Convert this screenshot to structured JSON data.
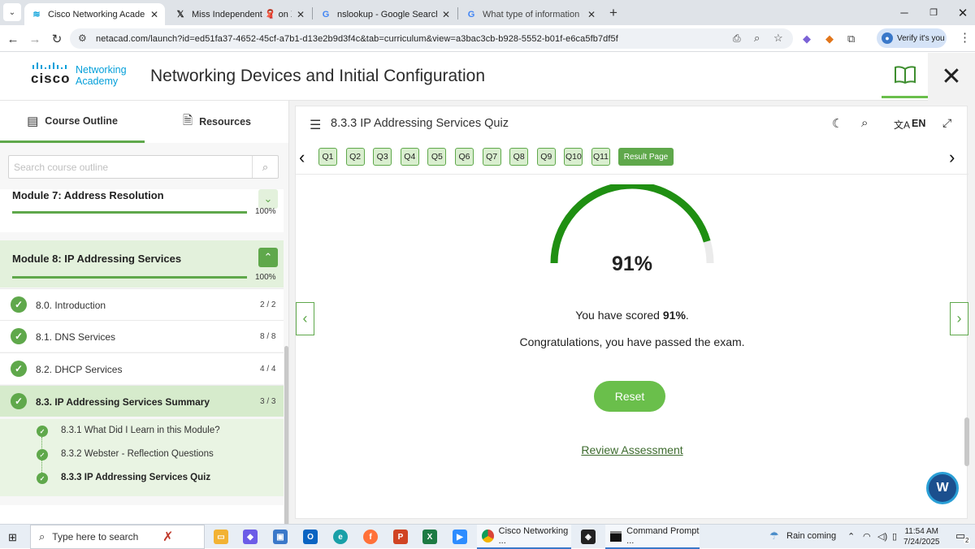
{
  "browser": {
    "tabs": [
      {
        "title": "Cisco Networking Academy: Ne",
        "active": true
      },
      {
        "title": "Miss Independent 🧣 on X: \"My",
        "active": false
      },
      {
        "title": "nslookup - Google Search",
        "active": false
      },
      {
        "title": "What type of information is con",
        "active": false
      }
    ],
    "url_host": "netacad.com",
    "url_path": "/launch?id=ed51fa37-4652-45cf-a7b1-d13e2b9d3f4c&tab=curriculum&view=a3bac3cb-b928-5552-b01f-e6ca5fb7df5f",
    "verify_label": "Verify it's you"
  },
  "header": {
    "logo_brand": "cisco",
    "logo_line1": "Networking",
    "logo_line2": "Academy",
    "title": "Networking Devices and Initial Configuration"
  },
  "sidebar": {
    "tabs": [
      {
        "label": "Course Outline",
        "active": true
      },
      {
        "label": "Resources",
        "active": false
      }
    ],
    "search_placeholder": "Search course outline",
    "modules": [
      {
        "title": "Module 7: Address Resolution",
        "progress": "100%",
        "expanded": false
      },
      {
        "title": "Module 8: IP Addressing Services",
        "progress": "100%",
        "expanded": true
      }
    ],
    "items": [
      {
        "label": "8.0. Introduction",
        "count": "2 / 2"
      },
      {
        "label": "8.1. DNS Services",
        "count": "8 / 8"
      },
      {
        "label": "8.2. DHCP Services",
        "count": "4 / 4"
      },
      {
        "label": "8.3. IP Addressing Services Summary",
        "count": "3 / 3",
        "selected": true
      }
    ],
    "subitems": [
      {
        "label": "8.3.1 What Did I Learn in this Module?"
      },
      {
        "label": "8.3.2 Webster - Reflection Questions"
      },
      {
        "label": "8.3.3 IP Addressing Services Quiz",
        "current": true
      }
    ]
  },
  "quiz": {
    "title": "8.3.3 IP Addressing Services Quiz",
    "language": "EN",
    "questions": [
      "Q1",
      "Q2",
      "Q3",
      "Q4",
      "Q5",
      "Q6",
      "Q7",
      "Q8",
      "Q9",
      "Q10",
      "Q11"
    ],
    "result_label": "Result Page",
    "score_fraction": 0.91,
    "score_text": "91%",
    "scored_prefix": "You have scored ",
    "scored_value": "91%",
    "scored_suffix": ".",
    "congrats": "Congratulations, you have passed the exam.",
    "reset_label": "Reset",
    "review_label": "Review Assessment"
  },
  "taskbar": {
    "search_placeholder": "Type here to search",
    "apps": [
      {
        "label": "Cisco Networking ..."
      },
      {
        "label": "Command Prompt ..."
      }
    ],
    "weather": "Rain coming",
    "time": "11:54 AM",
    "date": "7/24/2025",
    "notifications": "2"
  },
  "colors": {
    "accent_green": "#5fa84b",
    "gauge_green": "#1f8f12",
    "cisco_blue": "#049fd9"
  }
}
